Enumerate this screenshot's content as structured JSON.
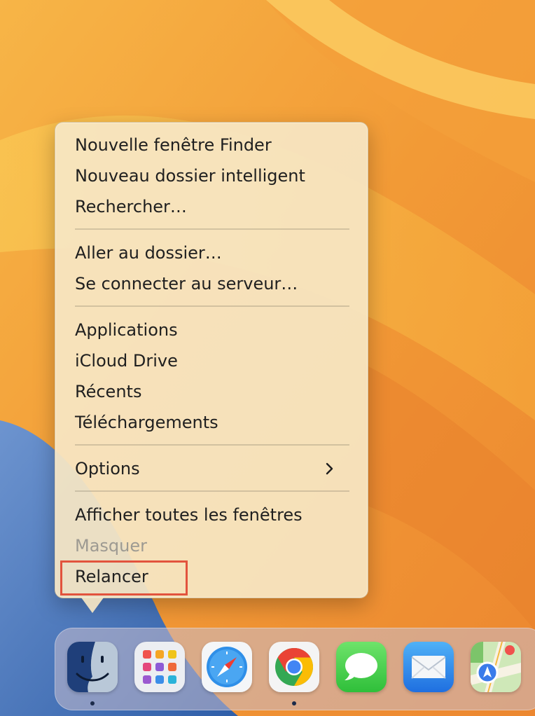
{
  "menu": {
    "groups": [
      [
        "Nouvelle fenêtre Finder",
        "Nouveau dossier intelligent",
        "Rechercher…"
      ],
      [
        "Aller au dossier…",
        "Se connecter au serveur…"
      ],
      [
        "Applications",
        "iCloud Drive",
        "Récents",
        "Téléchargements"
      ],
      [
        "Options"
      ],
      [
        "Afficher toutes les fenêtres",
        "Masquer",
        "Relancer"
      ]
    ],
    "disabled_items": [
      "Masquer"
    ],
    "submenu_items": [
      "Options"
    ],
    "highlighted_item": "Relancer",
    "highlight_color": "#e2533d"
  },
  "dock": {
    "apps": [
      {
        "name": "Finder",
        "icon": "finder-icon",
        "running": true
      },
      {
        "name": "Launchpad",
        "icon": "launchpad-icon",
        "running": false
      },
      {
        "name": "Safari",
        "icon": "safari-icon",
        "running": false
      },
      {
        "name": "Google Chrome",
        "icon": "chrome-icon",
        "running": true
      },
      {
        "name": "Messages",
        "icon": "messages-icon",
        "running": false
      },
      {
        "name": "Mail",
        "icon": "mail-icon",
        "running": false
      },
      {
        "name": "Plans",
        "icon": "maps-icon",
        "running": false
      }
    ]
  },
  "colors": {
    "wallpaper_orange": "#f2a03a",
    "wallpaper_blue": "#3d6fb8",
    "menu_background": "#f6e6c4"
  }
}
